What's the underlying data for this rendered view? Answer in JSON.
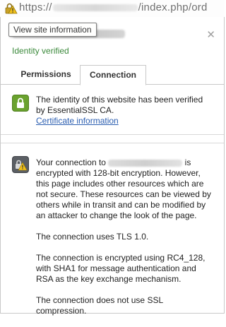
{
  "urlbar": {
    "protocol": "https://",
    "path": "/index.php/ord",
    "security_icon": "warning-lock-icon"
  },
  "tooltip": {
    "text": "View site information"
  },
  "popup": {
    "identity_status": "Identity verified",
    "close_icon": "close-icon",
    "tabs": [
      {
        "label": "Permissions",
        "active": false
      },
      {
        "label": "Connection",
        "active": true
      }
    ],
    "identity_section": {
      "icon": "lock-icon",
      "text": "The identity of this website has been verified by EssentialSSL CA.",
      "link": "Certificate information"
    },
    "connection_section": {
      "icon": "lock-warning-icon",
      "paragraph1_start": "Your connection to",
      "paragraph1_end": "is encrypted with 128-bit encryption. However, this page includes other resources which are not secure. These resources can be viewed by others while in transit and can be modified by an attacker to change the look of the page.",
      "paragraph2": "The connection uses TLS 1.0.",
      "paragraph3": "The connection is encrypted using RC4_128, with SHA1 for message authentication and RSA as the key exchange mechanism.",
      "paragraph4": "The connection does not use SSL compression."
    }
  },
  "colors": {
    "verified_green": "#3c8a3c",
    "link_blue": "#2a5db0",
    "lock_badge_green": "#6aa22e",
    "warning_badge_gray": "#5b5f64",
    "warning_yellow": "#f2c21b"
  }
}
